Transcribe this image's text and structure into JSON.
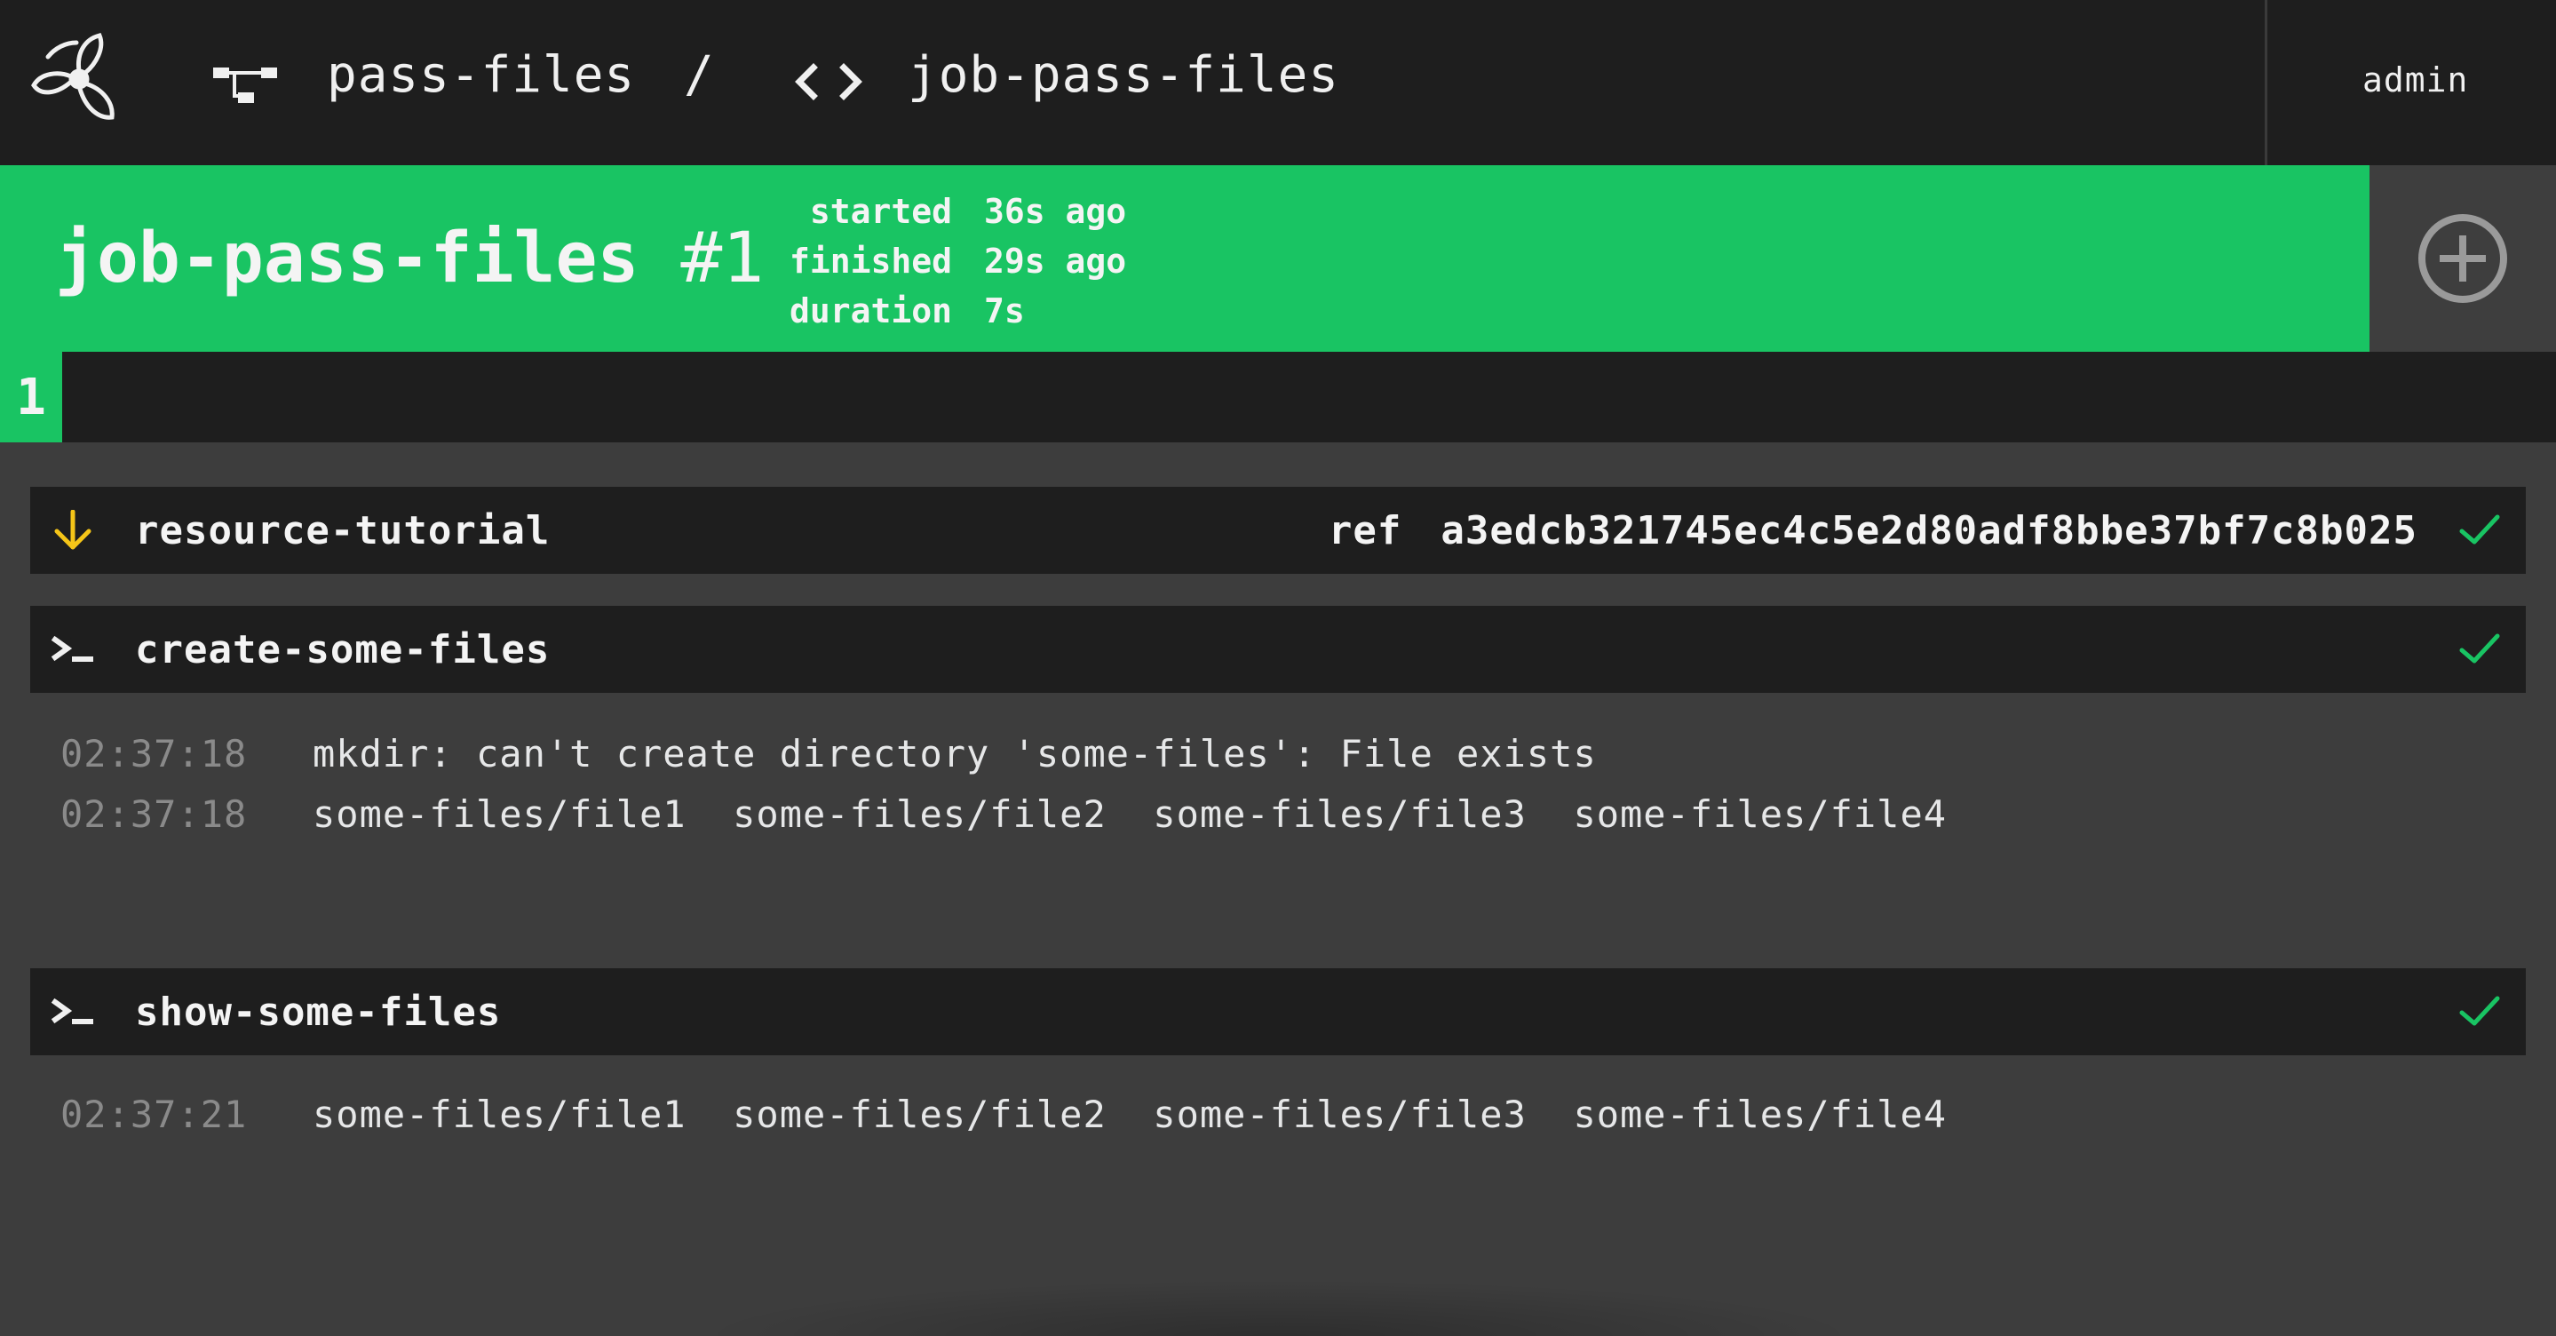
{
  "topbar": {
    "pipeline_name": "pass-files",
    "separator": "/",
    "job_name": "job-pass-files",
    "user": "admin"
  },
  "build": {
    "job_name": "job-pass-files",
    "number": "#1",
    "status_color": "#19c463",
    "meta": [
      {
        "label": "started",
        "value": "36s ago"
      },
      {
        "label": "finished",
        "value": "29s ago"
      },
      {
        "label": "duration",
        "value": "7s"
      }
    ]
  },
  "tabs": [
    {
      "label": "1",
      "active": true
    }
  ],
  "steps": [
    {
      "type": "get",
      "icon": "arrow-down-icon",
      "name": "resource-tutorial",
      "ref_label": "ref",
      "ref_value": "a3edcb321745ec4c5e2d80adf8bbe37bf7c8b025",
      "status": "succeeded",
      "logs": []
    },
    {
      "type": "task",
      "icon": "terminal-icon",
      "name": "create-some-files",
      "status": "succeeded",
      "logs": [
        {
          "time": "02:37:18",
          "text": "mkdir: can't create directory 'some-files': File exists"
        },
        {
          "time": "02:37:18",
          "text": "some-files/file1  some-files/file2  some-files/file3  some-files/file4"
        }
      ]
    },
    {
      "type": "task",
      "icon": "terminal-icon",
      "name": "show-some-files",
      "status": "succeeded",
      "logs": [
        {
          "time": "02:37:21",
          "text": "some-files/file1  some-files/file2  some-files/file3  some-files/file4"
        }
      ]
    }
  ],
  "colors": {
    "success": "#19c463",
    "get_icon": "#f5c518",
    "topbar_bg": "#1e1e1e",
    "page_bg": "#3d3d3d"
  }
}
